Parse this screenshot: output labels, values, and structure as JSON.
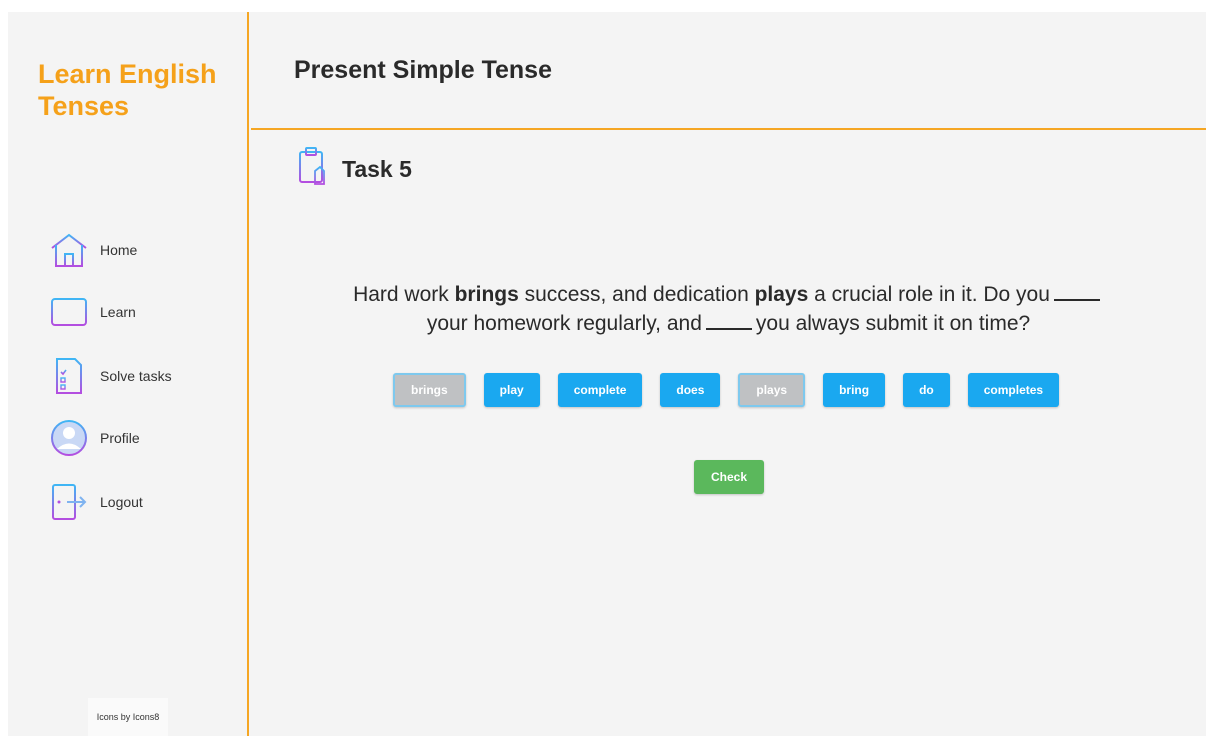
{
  "brand": "Learn English Tenses",
  "nav": [
    {
      "label": "Home",
      "icon": "home-icon"
    },
    {
      "label": "Learn",
      "icon": "book-icon"
    },
    {
      "label": "Solve tasks",
      "icon": "checklist-icon"
    },
    {
      "label": "Profile",
      "icon": "user-icon"
    },
    {
      "label": "Logout",
      "icon": "logout-door-icon"
    }
  ],
  "credit": "Icons by Icons8",
  "header": {
    "title": "Present Simple Tense"
  },
  "task": {
    "title": "Task 5",
    "icon": "clipboard-icon",
    "question": {
      "part1": "Hard work ",
      "bold1": "brings",
      "part2": " success, and dedication ",
      "bold2": "plays",
      "part3": " a crucial role in it. Do you",
      "part4": "your homework regularly, and",
      "part5": "you always submit it on time?"
    },
    "options": [
      {
        "label": "brings",
        "used": true
      },
      {
        "label": "play",
        "used": false
      },
      {
        "label": "complete",
        "used": false
      },
      {
        "label": "does",
        "used": false
      },
      {
        "label": "plays",
        "used": true
      },
      {
        "label": "bring",
        "used": false
      },
      {
        "label": "do",
        "used": false
      },
      {
        "label": "completes",
        "used": false
      }
    ],
    "check_label": "Check"
  },
  "colors": {
    "accent": "#f5a11a",
    "option": "#1aa8f0",
    "option_used": "#bfc1c3",
    "check": "#5bb85c"
  }
}
